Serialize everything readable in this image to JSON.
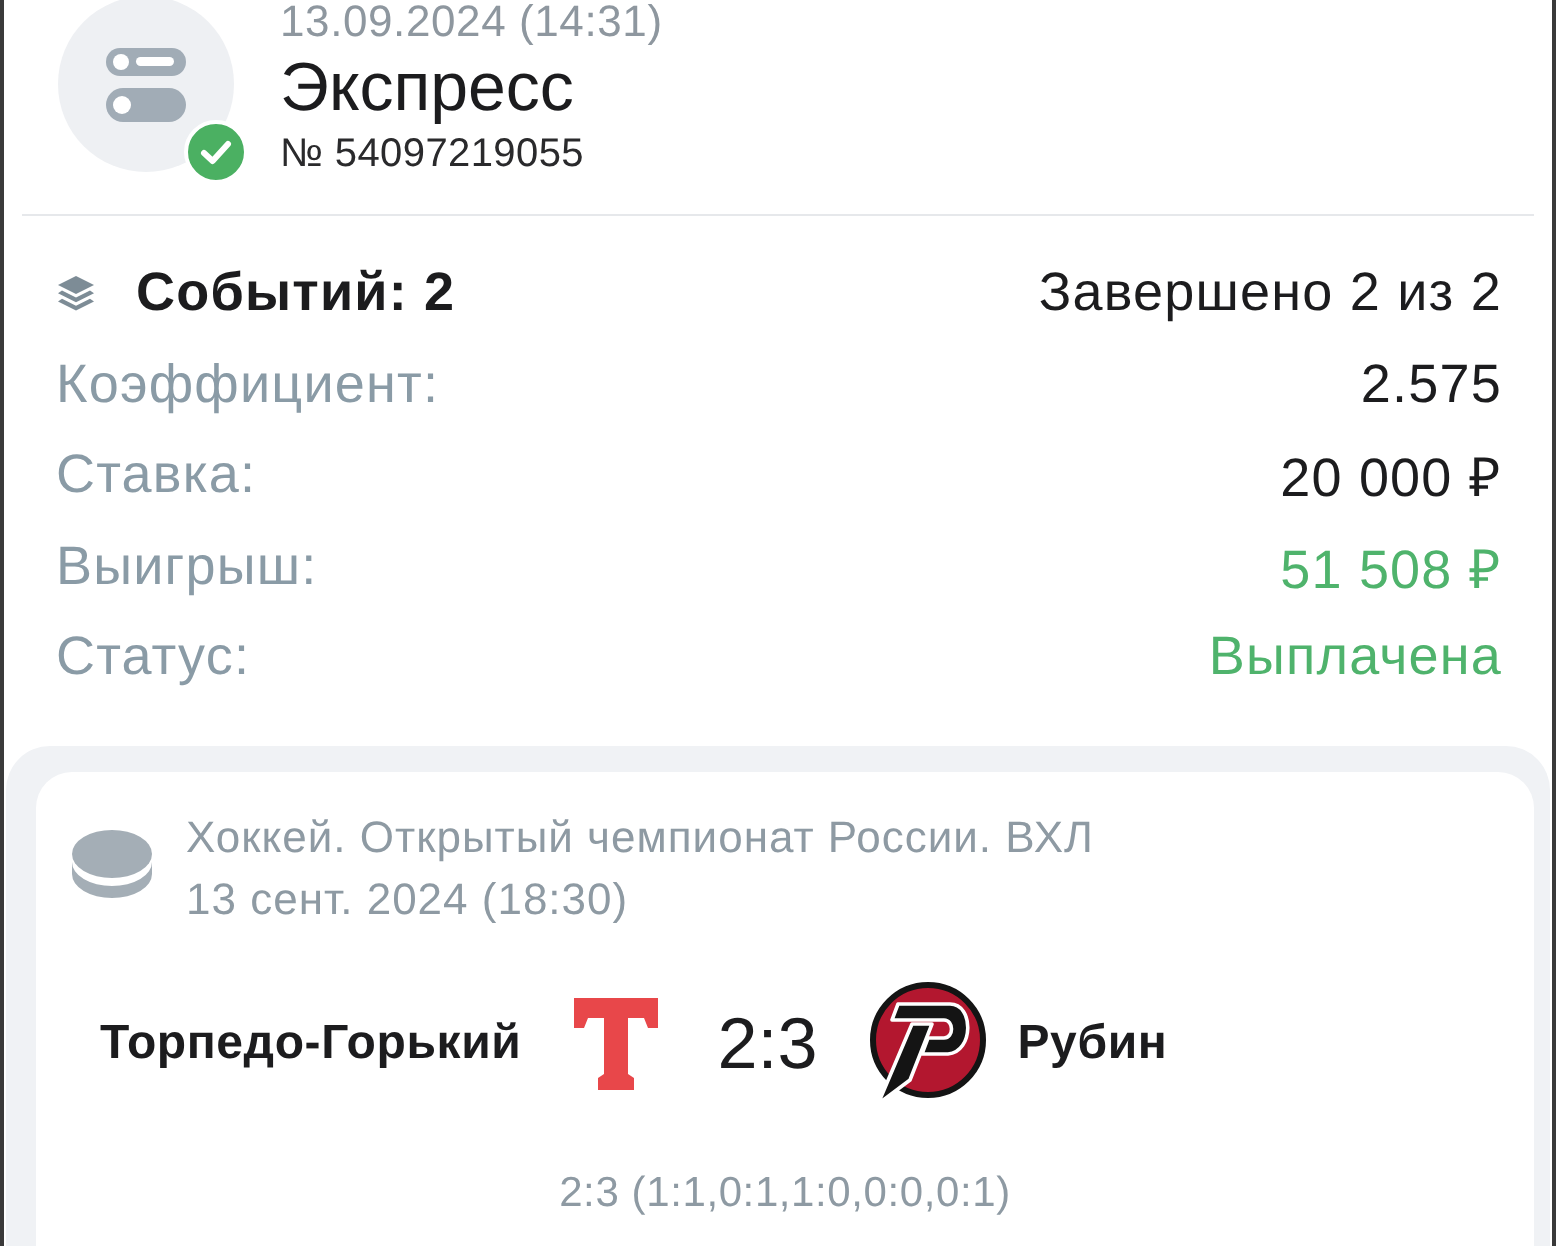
{
  "header": {
    "date": "13.09.2024 (14:31)",
    "title": "Экспресс",
    "number": "№ 54097219055"
  },
  "summary": {
    "events": "Событий: 2",
    "completed": "Завершено 2 из 2",
    "rows": [
      {
        "label": "Коэффициент:",
        "value": "2.575",
        "kind": "normal"
      },
      {
        "label": "Ставка:",
        "value": "20 000 ₽",
        "kind": "normal"
      },
      {
        "label": "Выигрыш:",
        "value": "51 508 ₽",
        "kind": "success"
      },
      {
        "label": "Статус:",
        "value": "Выплачена",
        "kind": "success"
      }
    ]
  },
  "events": [
    {
      "sport": "Хоккей. Открытый чемпионат России. ВХЛ",
      "date": "13 сент. 2024 (18:30)",
      "home_team": "Торпедо-Горький",
      "score": "2:3",
      "away_team": "Рубин",
      "periods": "2:3 (1:1,0:1,1:0,0:0,0:1)"
    }
  ]
}
